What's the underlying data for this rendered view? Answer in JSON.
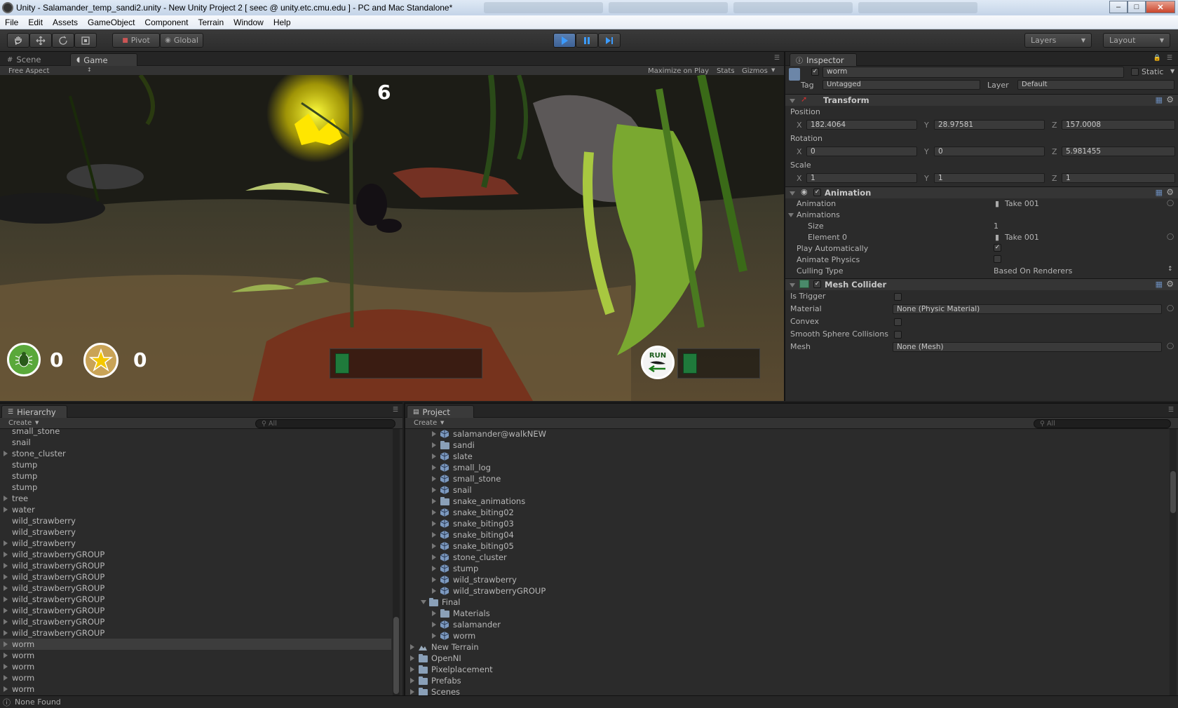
{
  "window": {
    "title": "Unity - Salamander_temp_sandi2.unity - New Unity Project 2 [ seec @ unity.etc.cmu.edu ] - PC and Mac Standalone*"
  },
  "menu": [
    "File",
    "Edit",
    "Assets",
    "GameObject",
    "Component",
    "Terrain",
    "Window",
    "Help"
  ],
  "toolbar": {
    "pivot_label": "Pivot",
    "global_label": "Global",
    "layers_label": "Layers",
    "layout_label": "Layout"
  },
  "game_panel": {
    "tabs": [
      "Scene",
      "Game"
    ],
    "aspect": "Free Aspect",
    "maximize_label": "Maximize on Play",
    "stats_label": "Stats",
    "gizmos_label": "Gizmos",
    "hud": {
      "top_count": "6",
      "bug_count": "0",
      "star_count": "0",
      "run_label": "RUN"
    }
  },
  "inspector": {
    "tab": "Inspector",
    "object_name": "worm",
    "static_label": "Static",
    "tag_label": "Tag",
    "tag_value": "Untagged",
    "layer_label": "Layer",
    "layer_value": "Default",
    "transform": {
      "title": "Transform",
      "position_label": "Position",
      "position": {
        "x": "182.4064",
        "y": "28.97581",
        "z": "157.0008"
      },
      "rotation_label": "Rotation",
      "rotation": {
        "x": "0",
        "y": "0",
        "z": "5.981455"
      },
      "scale_label": "Scale",
      "scale": {
        "x": "1",
        "y": "1",
        "z": "1"
      }
    },
    "animation": {
      "title": "Animation",
      "animation_label": "Animation",
      "animation_value": "Take 001",
      "animations_label": "Animations",
      "size_label": "Size",
      "size_value": "1",
      "element0_label": "Element 0",
      "element0_value": "Take 001",
      "play_auto_label": "Play Automatically",
      "animate_physics_label": "Animate Physics",
      "culling_label": "Culling Type",
      "culling_value": "Based On Renderers"
    },
    "mesh_collider": {
      "title": "Mesh Collider",
      "is_trigger_label": "Is Trigger",
      "material_label": "Material",
      "material_value": "None (Physic Material)",
      "convex_label": "Convex",
      "smooth_label": "Smooth Sphere Collisions",
      "mesh_label": "Mesh",
      "mesh_value": "None (Mesh)"
    }
  },
  "hierarchy": {
    "tab": "Hierarchy",
    "create_label": "Create",
    "search_placeholder": "All",
    "items": [
      {
        "label": "small_stone",
        "arrow": false
      },
      {
        "label": "snail",
        "arrow": false
      },
      {
        "label": "stone_cluster",
        "arrow": true
      },
      {
        "label": "stump",
        "arrow": false
      },
      {
        "label": "stump",
        "arrow": false
      },
      {
        "label": "stump",
        "arrow": false
      },
      {
        "label": "tree",
        "arrow": true
      },
      {
        "label": "water",
        "arrow": true
      },
      {
        "label": "wild_strawberry",
        "arrow": false
      },
      {
        "label": "wild_strawberry",
        "arrow": false
      },
      {
        "label": "wild_strawberry",
        "arrow": true
      },
      {
        "label": "wild_strawberryGROUP",
        "arrow": true
      },
      {
        "label": "wild_strawberryGROUP",
        "arrow": true
      },
      {
        "label": "wild_strawberryGROUP",
        "arrow": true
      },
      {
        "label": "wild_strawberryGROUP",
        "arrow": true
      },
      {
        "label": "wild_strawberryGROUP",
        "arrow": true
      },
      {
        "label": "wild_strawberryGROUP",
        "arrow": true
      },
      {
        "label": "wild_strawberryGROUP",
        "arrow": true
      },
      {
        "label": "wild_strawberryGROUP",
        "arrow": true
      },
      {
        "label": "worm",
        "arrow": true
      },
      {
        "label": "worm",
        "arrow": true
      },
      {
        "label": "worm",
        "arrow": true
      },
      {
        "label": "worm",
        "arrow": true
      },
      {
        "label": "worm",
        "arrow": true
      }
    ]
  },
  "project": {
    "tab": "Project",
    "create_label": "Create",
    "search_placeholder": "All",
    "items": [
      {
        "label": "salamander@walkNEW",
        "kind": "prefab",
        "level": 2
      },
      {
        "label": "sandi",
        "kind": "folder",
        "level": 2
      },
      {
        "label": "slate",
        "kind": "prefab",
        "level": 2
      },
      {
        "label": "small_log",
        "kind": "prefab",
        "level": 2
      },
      {
        "label": "small_stone",
        "kind": "prefab",
        "level": 2
      },
      {
        "label": "snail",
        "kind": "prefab",
        "level": 2
      },
      {
        "label": "snake_animations",
        "kind": "folder",
        "level": 2
      },
      {
        "label": "snake_biting02",
        "kind": "prefab",
        "level": 2
      },
      {
        "label": "snake_biting03",
        "kind": "prefab",
        "level": 2
      },
      {
        "label": "snake_biting04",
        "kind": "prefab",
        "level": 2
      },
      {
        "label": "snake_biting05",
        "kind": "prefab",
        "level": 2
      },
      {
        "label": "stone_cluster",
        "kind": "prefab",
        "level": 2
      },
      {
        "label": "stump",
        "kind": "prefab",
        "level": 2
      },
      {
        "label": "wild_strawberry",
        "kind": "prefab",
        "level": 2
      },
      {
        "label": "wild_strawberryGROUP",
        "kind": "prefab",
        "level": 2
      },
      {
        "label": "Final",
        "kind": "folder",
        "level": 1,
        "open": true
      },
      {
        "label": "Materials",
        "kind": "folder",
        "level": 2
      },
      {
        "label": "salamander",
        "kind": "prefab",
        "level": 2
      },
      {
        "label": "worm",
        "kind": "prefab",
        "level": 2
      },
      {
        "label": "New Terrain",
        "kind": "terrain",
        "level": 0
      },
      {
        "label": "OpenNI",
        "kind": "folder",
        "level": 0
      },
      {
        "label": "Pixelplacement",
        "kind": "folder",
        "level": 0
      },
      {
        "label": "Prefabs",
        "kind": "folder",
        "level": 0
      },
      {
        "label": "Scenes",
        "kind": "folder",
        "level": 0
      }
    ]
  },
  "status": {
    "text": "None Found"
  }
}
